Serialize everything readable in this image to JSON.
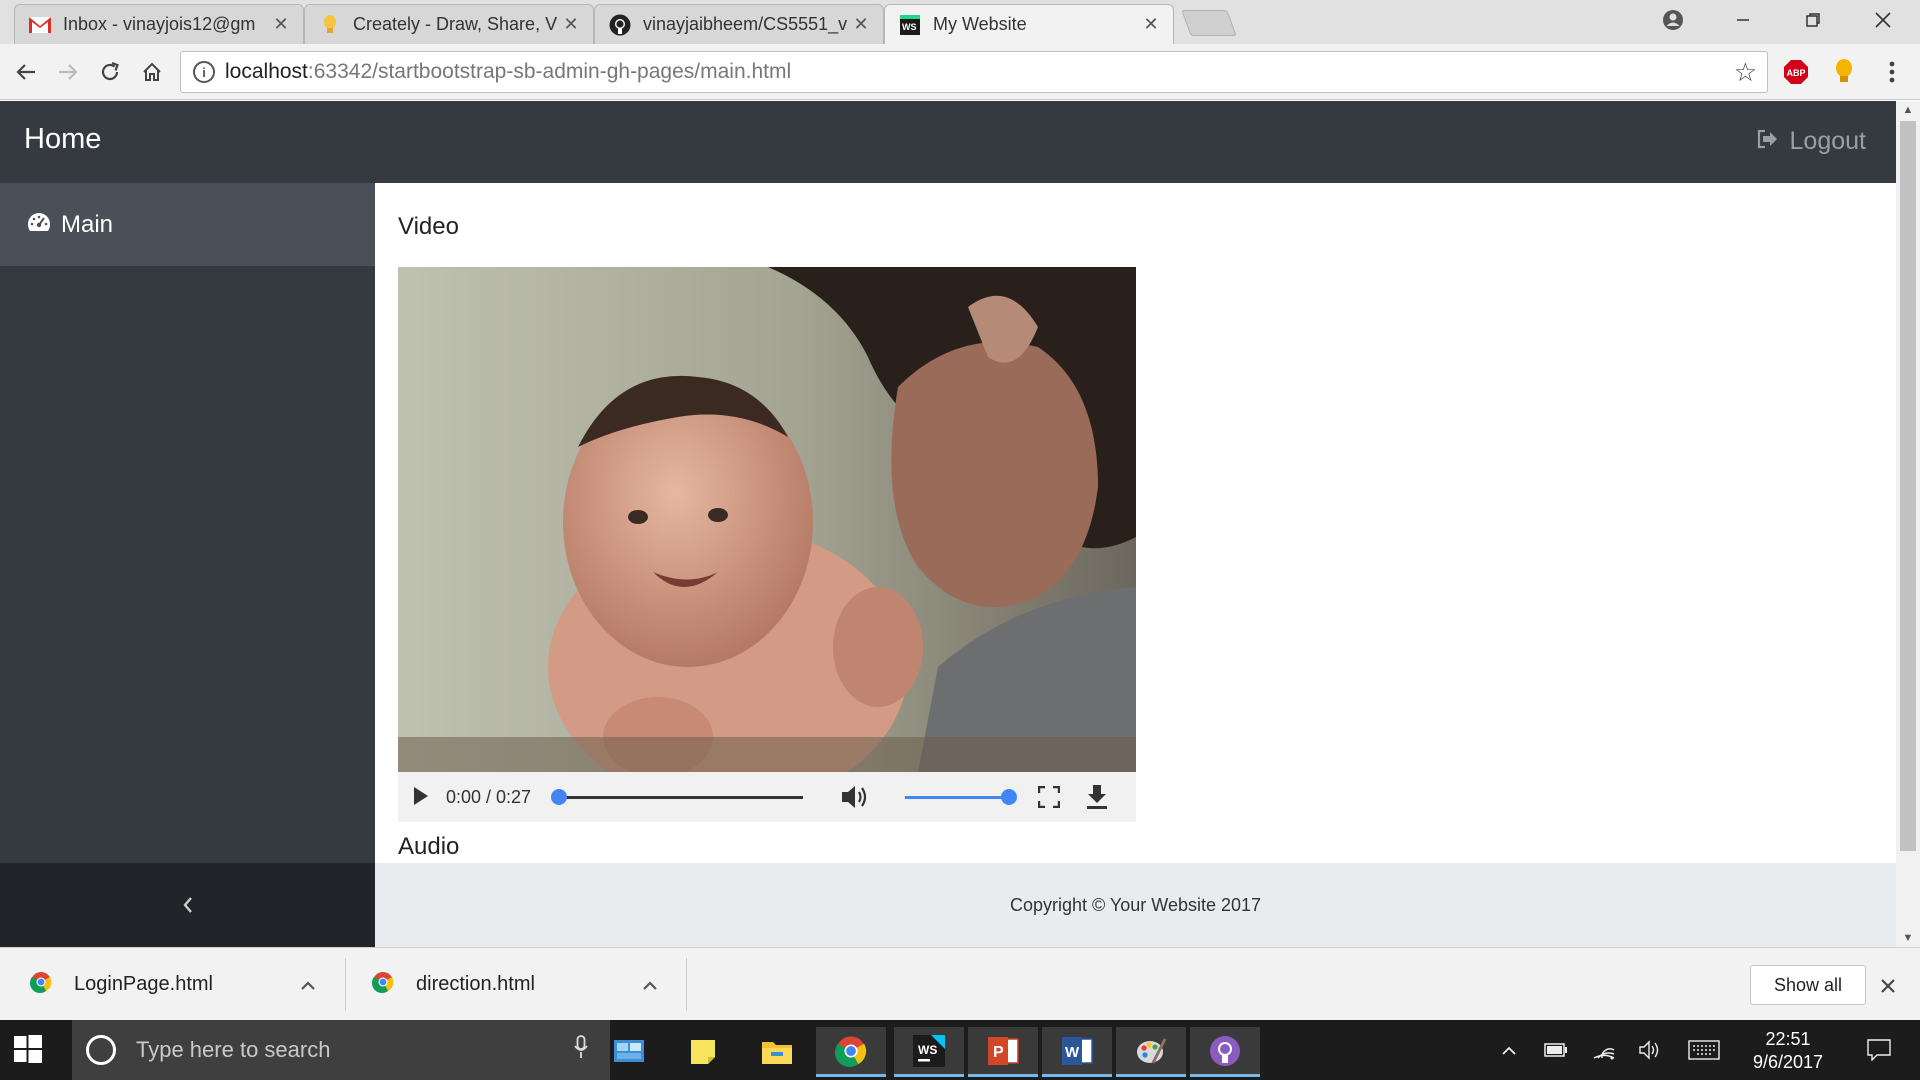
{
  "browser": {
    "tabs": [
      {
        "title": "Inbox - vinayjois12@gm",
        "favicon": "gmail-icon"
      },
      {
        "title": "Creately - Draw, Share, V",
        "favicon": "creately-icon"
      },
      {
        "title": "vinayjaibheem/CS5551_v",
        "favicon": "github-icon"
      },
      {
        "title": "My Website",
        "favicon": "webstorm-icon"
      }
    ],
    "url_host": "localhost",
    "url_rest": ":63342/startbootstrap-sb-admin-gh-pages/main.html",
    "extensions": {
      "adblock": "ABP"
    }
  },
  "page": {
    "brand": "Home",
    "logout_label": "Logout",
    "sidebar": {
      "items": [
        {
          "label": "Main",
          "icon": "dashboard-icon"
        }
      ]
    },
    "sections": {
      "video_heading": "Video",
      "audio_heading": "Audio"
    },
    "video": {
      "time": "0:00 / 0:27",
      "progress": 0.0,
      "volume": 1.0
    },
    "footer": "Copyright © Your Website 2017"
  },
  "downloads": {
    "items": [
      {
        "name": "LoginPage.html"
      },
      {
        "name": "direction.html"
      }
    ],
    "show_all": "Show all"
  },
  "taskbar": {
    "search_placeholder": "Type here to search",
    "time": "22:51",
    "date": "9/6/2017",
    "apps": [
      "control-panel-icon",
      "sticky-notes-icon",
      "file-explorer-icon",
      "chrome-icon",
      "webstorm-icon",
      "powerpoint-icon",
      "word-icon",
      "paint-icon",
      "github-desktop-icon"
    ]
  },
  "colors": {
    "navbar": "#343a40",
    "sidebar_active": "#495057",
    "footer": "#e9ecef",
    "accent": "#4285f4"
  }
}
